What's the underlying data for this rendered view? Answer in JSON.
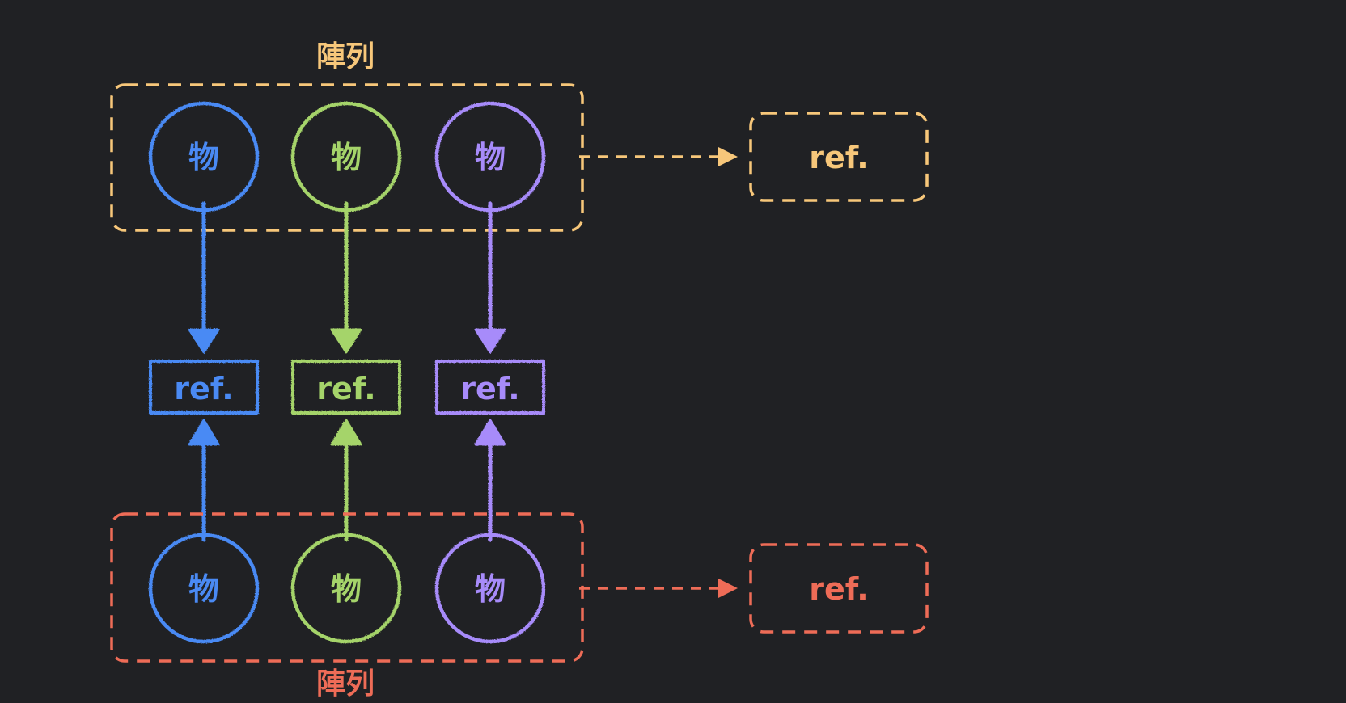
{
  "colors": {
    "background": "#202124",
    "blue": "#4a8af4",
    "green": "#a5d46a",
    "purple": "#a78bfa",
    "yellow": "#f7c77a",
    "red": "#ee6c57"
  },
  "top_group": {
    "label": "陣列",
    "ref_label": "ref."
  },
  "bottom_group": {
    "label": "陣列",
    "ref_label": "ref."
  },
  "columns": [
    {
      "color_key": "blue",
      "object_label": "物",
      "ref_label": "ref."
    },
    {
      "color_key": "green",
      "object_label": "物",
      "ref_label": "ref."
    },
    {
      "color_key": "purple",
      "object_label": "物",
      "ref_label": "ref."
    }
  ]
}
